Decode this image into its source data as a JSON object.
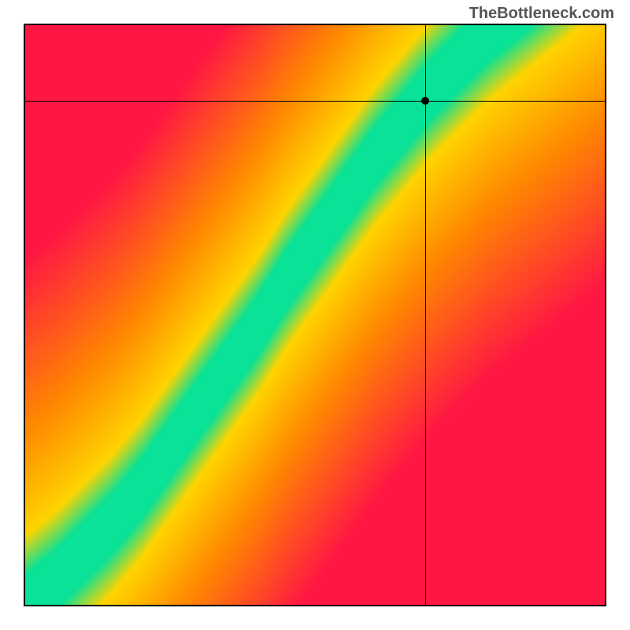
{
  "watermark": "TheBottleneck.com",
  "chart_data": {
    "type": "heatmap",
    "title": "",
    "xlabel": "",
    "ylabel": "",
    "xlim": [
      0,
      1
    ],
    "ylim": [
      0,
      1
    ],
    "crosshair": {
      "x": 0.69,
      "y": 0.87
    },
    "marker": {
      "x": 0.69,
      "y": 0.87
    },
    "optimal_curve": [
      {
        "x": 0.0,
        "y": 0.0
      },
      {
        "x": 0.05,
        "y": 0.04
      },
      {
        "x": 0.1,
        "y": 0.09
      },
      {
        "x": 0.15,
        "y": 0.14
      },
      {
        "x": 0.2,
        "y": 0.2
      },
      {
        "x": 0.25,
        "y": 0.27
      },
      {
        "x": 0.3,
        "y": 0.34
      },
      {
        "x": 0.35,
        "y": 0.41
      },
      {
        "x": 0.4,
        "y": 0.48
      },
      {
        "x": 0.45,
        "y": 0.56
      },
      {
        "x": 0.5,
        "y": 0.63
      },
      {
        "x": 0.55,
        "y": 0.7
      },
      {
        "x": 0.6,
        "y": 0.77
      },
      {
        "x": 0.65,
        "y": 0.83
      },
      {
        "x": 0.7,
        "y": 0.89
      },
      {
        "x": 0.75,
        "y": 0.94
      },
      {
        "x": 0.8,
        "y": 0.99
      },
      {
        "x": 0.85,
        "y": 1.03
      },
      {
        "x": 0.9,
        "y": 1.07
      },
      {
        "x": 0.95,
        "y": 1.11
      },
      {
        "x": 1.0,
        "y": 1.15
      }
    ],
    "band_halfwidth": 0.055,
    "colors": {
      "optimal": "#09e297",
      "mid": "#ffd400",
      "warn": "#ff8a00",
      "bad": "#ff1744"
    },
    "grid": false,
    "legend": false
  }
}
